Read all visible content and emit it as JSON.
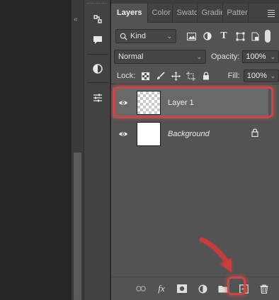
{
  "tabs": [
    {
      "label": "Layers",
      "active": true
    },
    {
      "label": "Color",
      "active": false
    },
    {
      "label": "Swatches",
      "active": false
    },
    {
      "label": "Gradients",
      "active": false
    },
    {
      "label": "Patterns",
      "active": false
    }
  ],
  "filter": {
    "kind_label": "Kind"
  },
  "blend": {
    "mode": "Normal",
    "opacity_label": "Opacity:",
    "opacity_value": "100%"
  },
  "lock": {
    "label": "Lock:",
    "fill_label": "Fill:",
    "fill_value": "100%"
  },
  "layers": [
    {
      "name": "Layer 1",
      "selected": true,
      "thumbnail": "transparent",
      "locked": false
    },
    {
      "name": "Background",
      "selected": false,
      "thumbnail": "white",
      "locked": true
    }
  ],
  "colors": {
    "accent_highlight": "#c24a4a",
    "panel_bg": "#535353"
  },
  "bottom_icons": [
    "link-layers-icon",
    "fx-icon",
    "layer-mask-icon",
    "adjustment-layer-icon",
    "group-folder-icon",
    "new-layer-icon",
    "trash-icon"
  ]
}
